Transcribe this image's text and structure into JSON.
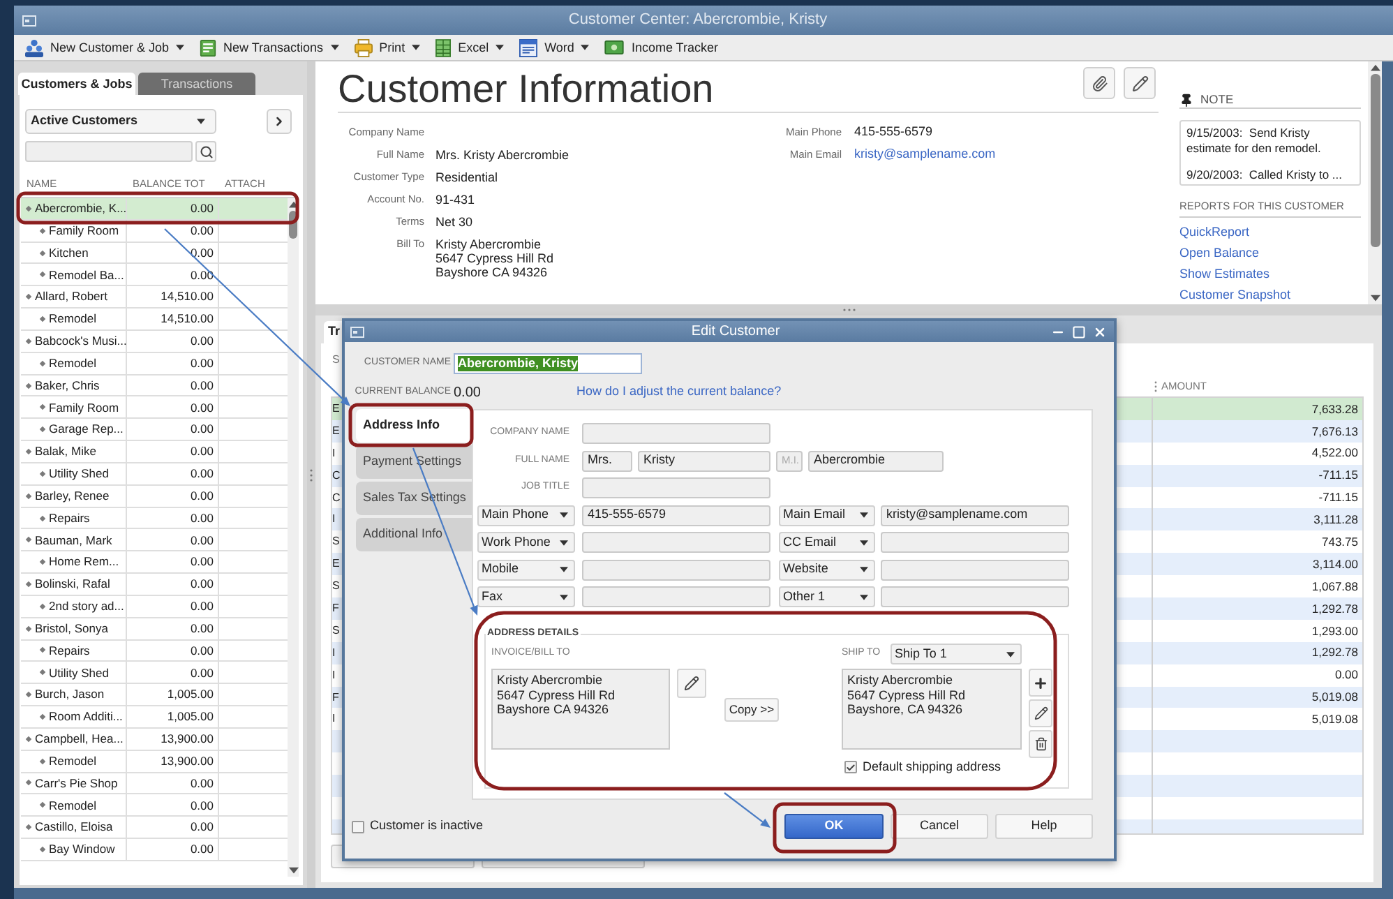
{
  "window": {
    "title": "Customer Center: Abercrombie, Kristy"
  },
  "toolbar": [
    {
      "label": "New Customer & Job",
      "kind": "menu"
    },
    {
      "label": "New Transactions",
      "kind": "menu"
    },
    {
      "label": "Print",
      "kind": "menu"
    },
    {
      "label": "Excel",
      "kind": "menu"
    },
    {
      "label": "Word",
      "kind": "menu"
    },
    {
      "label": "Income Tracker",
      "kind": "button"
    }
  ],
  "sidebar": {
    "tabs": [
      {
        "label": "Customers & Jobs",
        "selected": true
      },
      {
        "label": "Transactions",
        "selected": false
      }
    ],
    "filter": "Active Customers",
    "columns": [
      "NAME",
      "BALANCE TOT",
      "ATTACH"
    ],
    "customers": [
      {
        "name": "Abercrombie, K...",
        "balance": "0.00",
        "selected": true,
        "children": [
          {
            "name": "Family Room",
            "balance": "0.00",
            "selected": false
          },
          {
            "name": "Kitchen",
            "balance": "0.00",
            "selected": false
          },
          {
            "name": "Remodel Ba...",
            "balance": "0.00",
            "selected": false
          }
        ]
      },
      {
        "name": "Allard, Robert",
        "balance": "14,510.00",
        "selected": false,
        "children": [
          {
            "name": "Remodel",
            "balance": "14,510.00",
            "selected": false
          }
        ]
      },
      {
        "name": "Babcock's Musi...",
        "balance": "0.00",
        "selected": false,
        "children": [
          {
            "name": "Remodel",
            "balance": "0.00",
            "selected": false
          }
        ]
      },
      {
        "name": "Baker, Chris",
        "balance": "0.00",
        "selected": false,
        "children": [
          {
            "name": "Family Room",
            "balance": "0.00",
            "selected": false
          },
          {
            "name": "Garage Rep...",
            "balance": "0.00",
            "selected": false
          }
        ]
      },
      {
        "name": "Balak, Mike",
        "balance": "0.00",
        "selected": false,
        "children": [
          {
            "name": "Utility Shed",
            "balance": "0.00",
            "selected": false
          }
        ]
      },
      {
        "name": "Barley, Renee",
        "balance": "0.00",
        "selected": false,
        "children": [
          {
            "name": "Repairs",
            "balance": "0.00",
            "selected": false
          }
        ]
      },
      {
        "name": "Bauman, Mark",
        "balance": "0.00",
        "selected": false,
        "children": [
          {
            "name": "Home Rem...",
            "balance": "0.00",
            "selected": false
          }
        ]
      },
      {
        "name": "Bolinski, Rafal",
        "balance": "0.00",
        "selected": false,
        "children": [
          {
            "name": "2nd story ad...",
            "balance": "0.00",
            "selected": false
          }
        ]
      },
      {
        "name": "Bristol, Sonya",
        "balance": "0.00",
        "selected": false,
        "children": [
          {
            "name": "Repairs",
            "balance": "0.00",
            "selected": false
          },
          {
            "name": "Utility Shed",
            "balance": "0.00",
            "selected": false
          }
        ]
      },
      {
        "name": "Burch, Jason",
        "balance": "1,005.00",
        "selected": false,
        "children": [
          {
            "name": "Room Additi...",
            "balance": "1,005.00",
            "selected": false
          }
        ]
      },
      {
        "name": "Campbell, Hea...",
        "balance": "13,900.00",
        "selected": false,
        "children": [
          {
            "name": "Remodel",
            "balance": "13,900.00",
            "selected": false
          }
        ]
      },
      {
        "name": "Carr's Pie Shop",
        "balance": "0.00",
        "selected": false,
        "children": [
          {
            "name": "Remodel",
            "balance": "0.00",
            "selected": false
          }
        ]
      },
      {
        "name": "Castillo, Eloisa",
        "balance": "0.00",
        "selected": false,
        "children": [
          {
            "name": "Bay Window",
            "balance": "0.00",
            "selected": false
          }
        ]
      }
    ]
  },
  "customer_info": {
    "title": "Customer Information",
    "fields": [
      {
        "label": "Company Name"
      },
      {
        "label": "Full Name",
        "value": "Mrs. Kristy Abercrombie"
      },
      {
        "label": "Customer Type",
        "value": "Residential"
      },
      {
        "label": "Account No.",
        "value": "91-431"
      },
      {
        "label": "Terms",
        "value": "Net 30"
      },
      {
        "label": "Bill To",
        "lines": [
          "Kristy Abercrombie",
          "5647 Cypress Hill Rd",
          "Bayshore CA 94326"
        ]
      }
    ],
    "contacts": [
      {
        "label": "Main Phone",
        "value": "415-555-6579",
        "kind": "text"
      },
      {
        "label": "Main Email",
        "value": "kristy@samplename.com",
        "kind": "link"
      }
    ]
  },
  "note": {
    "heading": "NOTE",
    "entries": [
      "9/15/2003:  Send Kristy estimate for den remodel.",
      "9/20/2003:  Called Kristy to ..."
    ]
  },
  "reports": {
    "heading": "REPORTS FOR THIS CUSTOMER",
    "links": [
      "QuickReport",
      "Open Balance",
      "Show Estimates",
      "Customer Snapshot"
    ]
  },
  "transactions": {
    "tab": "Tr",
    "heading_fragment": "S",
    "amount_header": "AMOUNT",
    "rows": [
      {
        "column_1": "E",
        "amount": "7,633.28",
        "selected": true
      },
      {
        "column_1": "E",
        "amount": "7,676.13",
        "selected": false
      },
      {
        "column_1": "I",
        "amount": "4,522.00",
        "selected": false
      },
      {
        "column_1": "C",
        "amount": "-711.15",
        "selected": false
      },
      {
        "column_1": "C",
        "amount": "-711.15",
        "selected": false
      },
      {
        "column_1": "I",
        "amount": "3,111.28",
        "selected": false
      },
      {
        "column_1": "S",
        "amount": "743.75",
        "selected": false
      },
      {
        "column_1": "E",
        "amount": "3,114.00",
        "selected": false
      },
      {
        "column_1": "S",
        "amount": "1,067.88",
        "selected": false
      },
      {
        "column_1": "F",
        "amount": "1,292.78",
        "selected": false
      },
      {
        "column_1": "S",
        "amount": "1,293.00",
        "selected": false
      },
      {
        "column_1": "I",
        "amount": "1,292.78",
        "selected": false
      },
      {
        "column_1": "I",
        "amount": "0.00",
        "selected": false
      },
      {
        "column_1": "F",
        "amount": "5,019.08",
        "selected": false
      },
      {
        "column_1": "I",
        "amount": "5,019.08",
        "selected": false
      }
    ]
  },
  "dialog": {
    "title": "Edit Customer",
    "customer_name": {
      "label": "CUSTOMER NAME",
      "value": "Abercrombie, Kristy",
      "value_selected": true
    },
    "current_balance": {
      "label": "CURRENT BALANCE",
      "value": "0.00"
    },
    "balance_help_link": "How do I adjust the current balance?",
    "tabs": [
      {
        "label": "Address Info",
        "selected": true
      },
      {
        "label": "Payment Settings",
        "selected": false
      },
      {
        "label": "Sales Tax Settings",
        "selected": false
      },
      {
        "label": "Additional Info",
        "selected": false
      }
    ],
    "company_name": {
      "label": "COMPANY NAME"
    },
    "full_name": {
      "label": "FULL NAME",
      "title": "Mrs.",
      "first": "Kristy",
      "middle": {
        "placeholder": "M.I."
      },
      "last": "Abercrombie"
    },
    "job_title": {
      "label": "JOB TITLE"
    },
    "contact_rows": [
      {
        "left": {
          "type": "Main Phone",
          "value": "415-555-6579"
        },
        "right": {
          "type": "Main Email",
          "value": "kristy@samplename.com"
        }
      },
      {
        "left": {
          "type": "Work Phone"
        },
        "right": {
          "type": "CC Email"
        }
      },
      {
        "left": {
          "type": "Mobile"
        },
        "right": {
          "type": "Website"
        }
      },
      {
        "left": {
          "type": "Fax"
        },
        "right": {
          "type": "Other 1"
        }
      }
    ],
    "address_details": {
      "heading": "ADDRESS DETAILS",
      "bill_to": {
        "label": "INVOICE/BILL TO",
        "lines": [
          "Kristy Abercrombie",
          "5647 Cypress Hill Rd",
          "Bayshore CA 94326"
        ]
      },
      "copy_button": "Copy >>",
      "ship_to": {
        "label": "SHIP TO",
        "choice": "Ship To 1",
        "lines": [
          "Kristy Abercrombie",
          "5647 Cypress Hill Rd",
          "Bayshore, CA 94326"
        ]
      },
      "default_shipping": {
        "label": "Default shipping address",
        "checked": true
      }
    },
    "inactive": {
      "label": "Customer is inactive",
      "checked": false
    },
    "buttons": [
      {
        "label": "OK",
        "kind": "primary"
      },
      {
        "label": "Cancel",
        "kind": "normal"
      },
      {
        "label": "Help",
        "kind": "normal"
      }
    ]
  }
}
